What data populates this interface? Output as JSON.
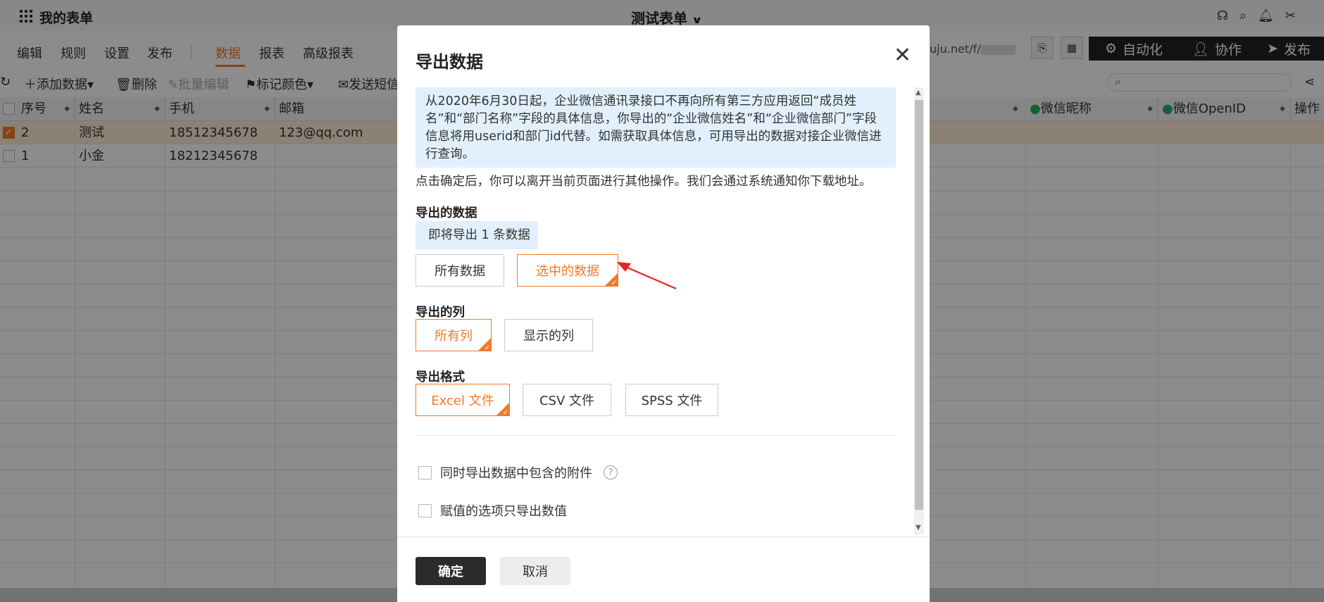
{
  "app": {
    "title": "我的表单",
    "form_title": "测试表单"
  },
  "nav": {
    "items": [
      "编辑",
      "规则",
      "设置",
      "发布"
    ],
    "data_tabs": [
      "数据",
      "报表",
      "高级报表"
    ],
    "active": "数据"
  },
  "header_right": {
    "url": "uju.net/f/",
    "automation": "自动化",
    "collaborate": "协作",
    "publish": "发布"
  },
  "toolbar": {
    "add": "添加数据",
    "delete": "删除",
    "batch_edit": "批量编辑",
    "mark_color": "标记颜色",
    "send_sms": "发送短信"
  },
  "table": {
    "columns": [
      "序号",
      "姓名",
      "手机",
      "邮箱"
    ],
    "right_columns": [
      "微信昵称",
      "微信OpenID",
      "操作"
    ],
    "rows": [
      {
        "no": "2",
        "name": "测试",
        "phone": "18512345678",
        "email": "123@qq.com",
        "checked": true
      },
      {
        "no": "1",
        "name": "小金",
        "phone": "18212345678",
        "email": "",
        "checked": false
      }
    ]
  },
  "modal": {
    "title": "导出数据",
    "notice": "从2020年6月30日起，企业微信通讯录接口不再向所有第三方应用返回“成员姓名”和“部门名称”字段的具体信息，你导出的“企业微信姓名”和“企业微信部门”字段信息将用userid和部门id代替。如需获取具体信息，可用导出的数据对接企业微信进行查询。",
    "info": "点击确定后，你可以离开当前页面进行其他操作。我们会通过系统通知你下载地址。",
    "export_data_label": "导出的数据",
    "count_text": "即将导出 1 条数据",
    "data_options": [
      "所有数据",
      "选中的数据"
    ],
    "export_columns_label": "导出的列",
    "column_options": [
      "所有列",
      "显示的列"
    ],
    "format_label": "导出格式",
    "format_options": [
      "Excel 文件",
      "CSV 文件",
      "SPSS 文件"
    ],
    "attach_label": "同时导出数据中包含的附件",
    "value_label": "赋值的选项只导出数值",
    "ok": "确定",
    "cancel": "取消"
  },
  "colors": {
    "accent": "#f07a2a",
    "dark": "#222222",
    "notice_bg": "#e1f0fc"
  }
}
